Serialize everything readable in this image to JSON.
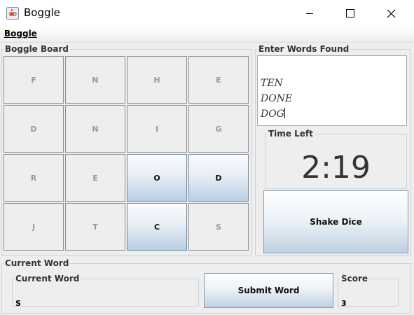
{
  "window": {
    "title": "Boggle"
  },
  "menu": {
    "items": [
      {
        "label": "Boggle"
      }
    ]
  },
  "board": {
    "legend": "Boggle Board",
    "dice": [
      {
        "letter": "F",
        "selected": false
      },
      {
        "letter": "N",
        "selected": false
      },
      {
        "letter": "H",
        "selected": false
      },
      {
        "letter": "E",
        "selected": false
      },
      {
        "letter": "D",
        "selected": false
      },
      {
        "letter": "N",
        "selected": false
      },
      {
        "letter": "I",
        "selected": false
      },
      {
        "letter": "G",
        "selected": false
      },
      {
        "letter": "R",
        "selected": false
      },
      {
        "letter": "E",
        "selected": false
      },
      {
        "letter": "O",
        "selected": true
      },
      {
        "letter": "D",
        "selected": true
      },
      {
        "letter": "J",
        "selected": false
      },
      {
        "letter": "T",
        "selected": false
      },
      {
        "letter": "C",
        "selected": true
      },
      {
        "letter": "S",
        "selected": false
      }
    ]
  },
  "words_found": {
    "legend": "Enter Words Found",
    "lines": [
      "TEN",
      "DONE",
      "DOG"
    ]
  },
  "time_left": {
    "legend": "Time Left",
    "value": "2:19"
  },
  "shake_button": {
    "label": "Shake Dice"
  },
  "current_word_panel": {
    "legend": "Current Word",
    "field_legend": "Current Word",
    "value": "S",
    "submit_label": "Submit Word",
    "score_legend": "Score",
    "score_value": "3"
  }
}
